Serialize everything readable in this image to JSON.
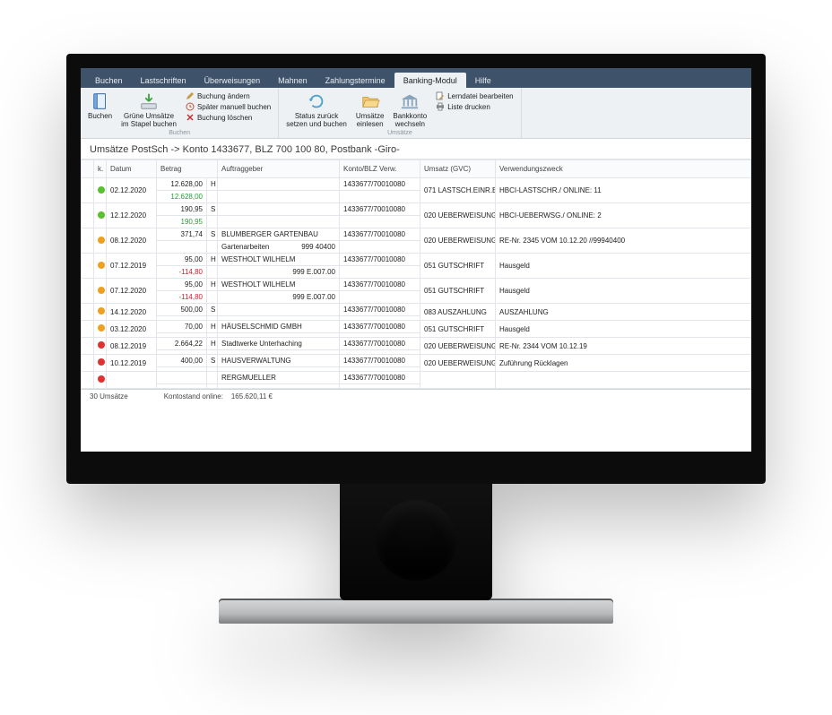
{
  "tabs": [
    "Buchen",
    "Lastschriften",
    "Überweisungen",
    "Mahnen",
    "Zahlungstermine",
    "Banking-Modul",
    "Hilfe"
  ],
  "active_tab": 5,
  "ribbon": {
    "group_labels": {
      "buchen": "Buchen",
      "umsaetze": "Umsätze"
    },
    "buchen_btn": "Buchen",
    "stapel_btn": "Grüne Umsätze\nim Stapel buchen",
    "buchung_aendern": "Buchung ändern",
    "spaeter_manuell": "Später manuell buchen",
    "buchung_loeschen": "Buchung löschen",
    "status_btn": "Status zurück\nsetzen und buchen",
    "umsaetze_btn": "Umsätze\neinlesen",
    "bankkonto_btn": "Bankkonto\nwechseln",
    "lerndatei": "Lerndatei bearbeiten",
    "liste_drucken": "Liste drucken"
  },
  "page_title": "Umsätze PostSch -> Konto 1433677, BLZ 700 100 80, Postbank -Giro-",
  "columns": {
    "status": "",
    "mark": "k.",
    "datum": "Datum",
    "betrag": "Betrag",
    "hs": "",
    "auftraggeber": "Auftraggeber",
    "konto": "Konto/BLZ Verw.",
    "umsatz": "Umsatz (GVC)",
    "zweck": "Verwendungszweck"
  },
  "rows": [
    {
      "dot": "g",
      "datum": "02.12.2020",
      "betrag": "12.628,00",
      "hs": "H",
      "sub_betrag": "12.628,00",
      "sub_color": "green",
      "auftraggeber": "",
      "sub_auftr": "",
      "sub_ktn": "",
      "konto": "1433677/70010080",
      "gvc": "071 LASTSCH.EINR.E",
      "zweck": "HBCI-LASTSCHR./ ONLINE:  11"
    },
    {
      "dot": "g",
      "datum": "12.12.2020",
      "betrag": "190,95",
      "hs": "S",
      "sub_betrag": "190,95",
      "sub_color": "green",
      "auftraggeber": "",
      "sub_auftr": "",
      "sub_ktn": "",
      "konto": "1433677/70010080",
      "gvc": "020 UEBERWEISUNG",
      "zweck": "HBCI-UEBERWSG./ ONLINE:   2"
    },
    {
      "dot": "o",
      "datum": "08.12.2020",
      "betrag": "371,74",
      "hs": "S",
      "sub_betrag": "",
      "sub_color": "",
      "auftraggeber": "BLUMBERGER GARTENBAU",
      "sub_auftr": "Gartenarbeiten",
      "sub_ktn": "999  40400",
      "konto": "1433677/70010080",
      "gvc": "020 UEBERWEISUNG",
      "zweck": "RE-Nr. 2345 VOM 10.12.20  //99940400"
    },
    {
      "dot": "o",
      "datum": "07.12.2019",
      "betrag": "95,00",
      "hs": "H",
      "sub_betrag": "-114,80",
      "sub_color": "red",
      "auftraggeber": "WESTHOLT WILHELM",
      "sub_auftr": "",
      "sub_ktn": "999  E.007.00",
      "konto": "1433677/70010080",
      "gvc": "051 GUTSCHRIFT",
      "zweck": "Hausgeld"
    },
    {
      "dot": "o",
      "datum": "07.12.2020",
      "betrag": "95,00",
      "hs": "H",
      "sub_betrag": "-114,80",
      "sub_color": "red",
      "auftraggeber": "WESTHOLT WILHELM",
      "sub_auftr": "",
      "sub_ktn": "999  E.007.00",
      "konto": "1433677/70010080",
      "gvc": "051 GUTSCHRIFT",
      "zweck": "Hausgeld"
    },
    {
      "dot": "o",
      "datum": "14.12.2020",
      "betrag": "500,00",
      "hs": "S",
      "sub_betrag": "",
      "sub_color": "",
      "auftraggeber": "",
      "sub_auftr": "",
      "sub_ktn": "",
      "konto": "1433677/70010080",
      "gvc": "083 AUSZAHLUNG",
      "zweck": "AUSZAHLUNG"
    },
    {
      "dot": "o",
      "datum": "03.12.2020",
      "betrag": "70,00",
      "hs": "H",
      "sub_betrag": "",
      "sub_color": "",
      "auftraggeber": "HÄUSELSCHMID GMBH",
      "sub_auftr": "",
      "sub_ktn": "",
      "konto": "1433677/70010080",
      "gvc": "051 GUTSCHRIFT",
      "zweck": "Hausgeld"
    },
    {
      "dot": "r",
      "datum": "08.12.2019",
      "betrag": "2.664,22",
      "hs": "H",
      "sub_betrag": "",
      "sub_color": "",
      "auftraggeber": "Stadtwerke Unterhaching",
      "sub_auftr": "",
      "sub_ktn": "",
      "konto": "1433677/70010080",
      "gvc": "020 UEBERWEISUNG",
      "zweck": "RE-Nr. 2344 VOM 10.12.19"
    },
    {
      "dot": "r",
      "datum": "10.12.2019",
      "betrag": "400,00",
      "hs": "S",
      "sub_betrag": "",
      "sub_color": "",
      "auftraggeber": "HAUSVERWALTUNG",
      "sub_auftr": "",
      "sub_ktn": "",
      "konto": "1433677/70010080",
      "gvc": "020 UEBERWEISUNG",
      "zweck": "Zuführung Rücklagen"
    },
    {
      "dot": "r",
      "datum": "",
      "betrag": "",
      "hs": "",
      "sub_betrag": "",
      "sub_color": "",
      "auftraggeber": "RERGMUELLER",
      "sub_auftr": "",
      "sub_ktn": "",
      "konto": "1433677/70010080",
      "gvc": "",
      "zweck": ""
    }
  ],
  "status": {
    "count": "30 Umsätze",
    "balance_label": "Kontostand online:",
    "balance": "165.620,11 €"
  }
}
